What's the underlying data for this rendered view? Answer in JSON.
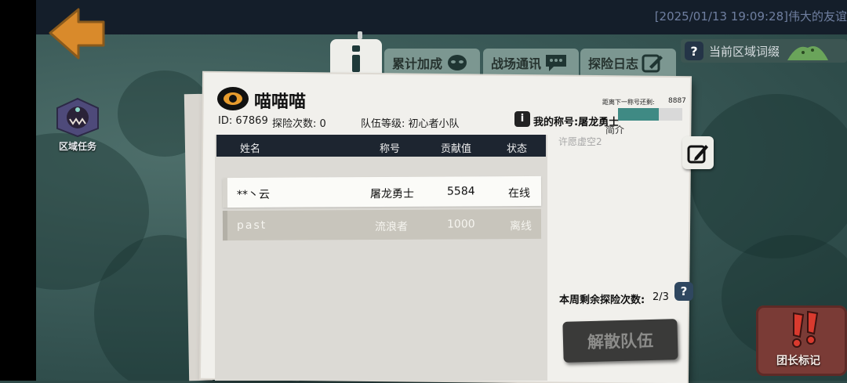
{
  "ticker": "[2025/01/13 19:09:28]伟大的友谊",
  "region_task": {
    "label": "区域任务"
  },
  "tabs": {
    "accumulate": "累计加成",
    "battle_comm": "战场通讯",
    "adventure_log": "探险日志"
  },
  "region_words": "当前区域词缀",
  "team": {
    "name": "喵喵喵",
    "id_text": "ID: 67869",
    "adventures": "探险次数: 0",
    "level": "队伍等级: 初心者小队",
    "next_title_label": "距离下一称号还剩:",
    "next_title_count": "8887",
    "my_title": "我的称号:屠龙勇士",
    "intro_label": "简介",
    "intro_text": "许愿虚空2"
  },
  "table": {
    "headers": [
      "姓名",
      "称号",
      "贡献值",
      "状态"
    ],
    "rows": [
      {
        "name": "**丶云",
        "title": "屠龙勇士",
        "contribution": "5584",
        "status": "在线"
      },
      {
        "name": "past",
        "title": "流浪者",
        "contribution": "1000",
        "status": "离线"
      }
    ]
  },
  "weekly": {
    "label": "本周剩余探险次数:",
    "value": "2/3"
  },
  "disband_label": "解散队伍",
  "leader_mark_label": "团长标记",
  "colors": {
    "accent_teal": "#3f8a84",
    "header_dark": "#1d2530",
    "back_orange": "#d98a2b"
  },
  "icons": [
    "back-arrow-icon",
    "monster-icon",
    "info-icon",
    "alien-icon",
    "chat-icon",
    "edit-icon",
    "terrain-icon",
    "eye-icon",
    "question-icon",
    "exclamation-icon"
  ]
}
